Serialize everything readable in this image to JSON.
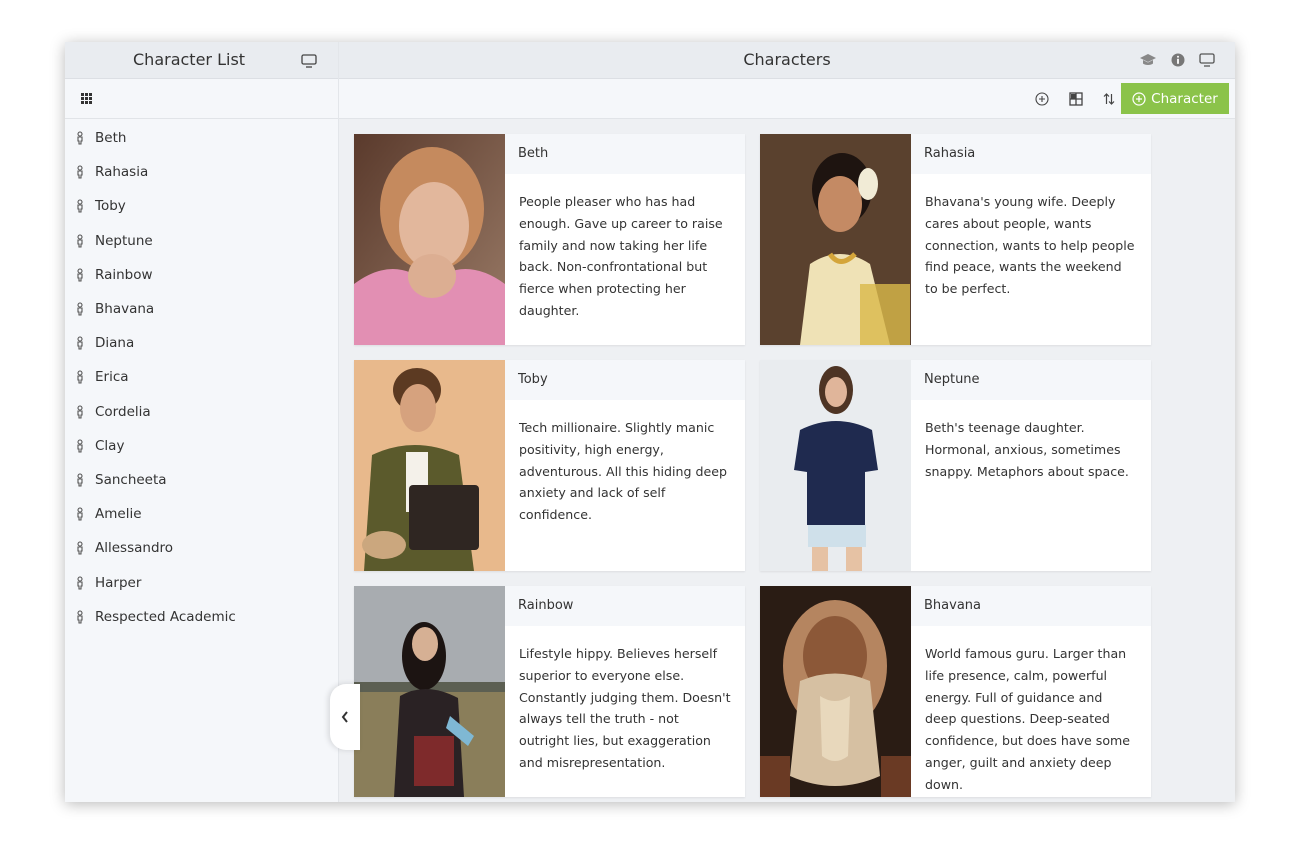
{
  "sidebar": {
    "title": "Character List",
    "items": [
      {
        "label": "Beth"
      },
      {
        "label": "Rahasia"
      },
      {
        "label": "Toby"
      },
      {
        "label": "Neptune"
      },
      {
        "label": "Rainbow"
      },
      {
        "label": "Bhavana"
      },
      {
        "label": "Diana"
      },
      {
        "label": "Erica"
      },
      {
        "label": "Cordelia"
      },
      {
        "label": "Clay"
      },
      {
        "label": "Sancheeta"
      },
      {
        "label": "Amelie"
      },
      {
        "label": "Allessandro"
      },
      {
        "label": "Harper"
      },
      {
        "label": "Respected Academic"
      }
    ]
  },
  "main": {
    "title": "Characters",
    "add_character_label": "Character",
    "icons": [
      "graduation-cap-icon",
      "info-icon",
      "monitor-icon",
      "add-circle-icon",
      "layout-icon",
      "sort-icon"
    ],
    "accent_color": "#8bc34a"
  },
  "cards": [
    {
      "name": "Beth",
      "description": "People pleaser who has had enough. Gave up career to raise family and now taking her life back. Non-confrontational but fierce when protecting her daughter."
    },
    {
      "name": "Rahasia",
      "description": "Bhavana's young wife. Deeply cares about people, wants connection, wants to help people find peace, wants the weekend to be perfect."
    },
    {
      "name": "Toby",
      "description": "Tech millionaire. Slightly manic positivity, high energy, adventurous. All this hiding deep anxiety and lack of self confidence."
    },
    {
      "name": "Neptune",
      "description": "Beth's teenage daughter. Hormonal, anxious, sometimes snappy. Metaphors about space."
    },
    {
      "name": "Rainbow",
      "description": "Lifestyle hippy. Believes herself superior to everyone else. Constantly judging them. Doesn't always tell the truth - not outright lies, but exaggeration and misrepresentation."
    },
    {
      "name": "Bhavana",
      "description": "World famous guru. Larger than life presence, calm, powerful energy. Full of guidance and deep questions. Deep-seated confidence, but does have some anger, guilt and anxiety deep down."
    }
  ]
}
